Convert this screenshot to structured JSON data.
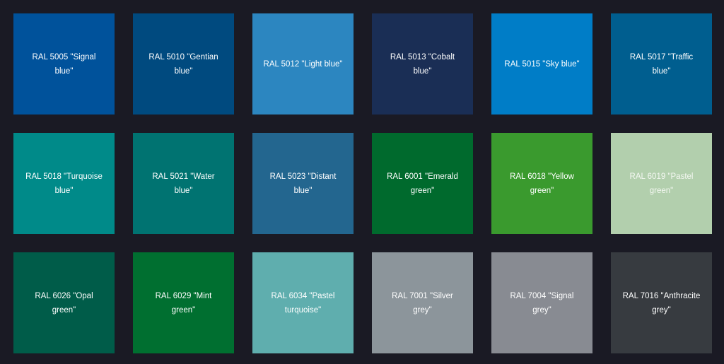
{
  "swatches": [
    {
      "label": "RAL 5005 \"Signal blue\"",
      "color": "#00529b"
    },
    {
      "label": "RAL 5010 \"Gentian blue\"",
      "color": "#004a7f"
    },
    {
      "label": "RAL 5012 \"Light blue\"",
      "color": "#2c86c0"
    },
    {
      "label": "RAL 5013 \"Cobalt blue\"",
      "color": "#1a2e55"
    },
    {
      "label": "RAL 5015 \"Sky blue\"",
      "color": "#007dc7"
    },
    {
      "label": "RAL 5017 \"Traffic blue\"",
      "color": "#005e8f"
    },
    {
      "label": "RAL 5018 \"Turquoise blue\"",
      "color": "#008a89"
    },
    {
      "label": "RAL 5021 \"Water blue\"",
      "color": "#007371"
    },
    {
      "label": "RAL 5023 \"Distant blue\"",
      "color": "#23668f"
    },
    {
      "label": "RAL 6001 \"Emerald green\"",
      "color": "#006a2d"
    },
    {
      "label": "RAL 6018 \"Yellow green\"",
      "color": "#3a9a2e"
    },
    {
      "label": "RAL 6019 \"Pastel green\"",
      "color": "#b2cfad"
    },
    {
      "label": "RAL 6026 \"Opal green\"",
      "color": "#005c49"
    },
    {
      "label": "RAL 6029 \"Mint green\"",
      "color": "#006f30"
    },
    {
      "label": "RAL 6034 \"Pastel turquoise\"",
      "color": "#5faeae"
    },
    {
      "label": "RAL 7001 \"Silver grey\"",
      "color": "#8c959b"
    },
    {
      "label": "RAL 7004 \"Signal grey\"",
      "color": "#888b92"
    },
    {
      "label": "RAL 7016 \"Anthracite grey\"",
      "color": "#373b40"
    }
  ]
}
